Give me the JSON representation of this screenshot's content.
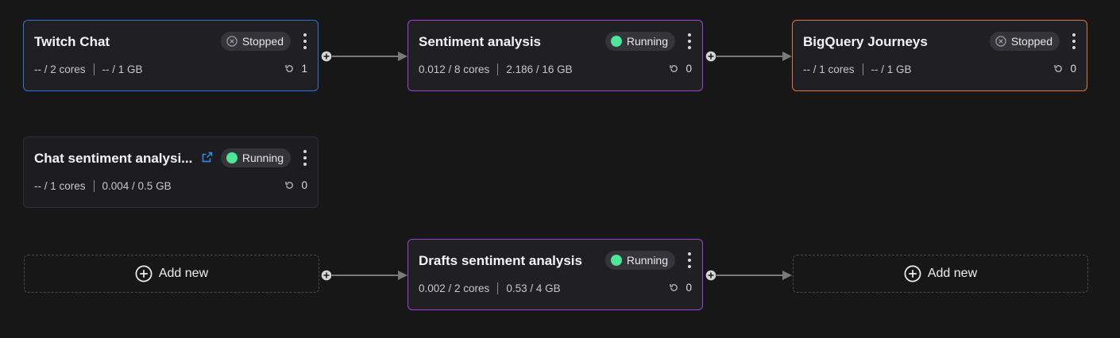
{
  "pipeline": {
    "row1": [
      {
        "title": "Twitch Chat",
        "status": "Stopped",
        "cpu": "-- / 2 cores",
        "memory": "-- / 1 GB",
        "restarts": "1",
        "border_color": "#2f6fe0"
      },
      {
        "title": "Sentiment analysis",
        "status": "Running",
        "cpu": "0.012 / 8 cores",
        "memory": "2.186 / 16 GB",
        "restarts": "0",
        "border_color": "#a33fd6"
      },
      {
        "title": "BigQuery Journeys",
        "status": "Stopped",
        "cpu": "-- / 1 cores",
        "memory": "-- / 1 GB",
        "restarts": "0",
        "border_color": "#e2733a"
      }
    ],
    "row2": [
      {
        "title": "Chat sentiment analysi...",
        "status": "Running",
        "cpu": "-- / 1 cores",
        "memory": "0.004 / 0.5 GB",
        "restarts": "0",
        "icon": "external-link-icon"
      }
    ],
    "row3": {
      "add_left_label": "Add new",
      "card": {
        "title": "Drafts sentiment analysis",
        "status": "Running",
        "cpu": "0.002 / 2 cores",
        "memory": "0.53 / 4 GB",
        "restarts": "0",
        "border_color": "#a33fd6"
      },
      "add_right_label": "Add new"
    }
  },
  "colors": {
    "background": "#171717",
    "running": "#4fe59a",
    "stopped_badge": "#34343a",
    "connector": "#7a7a7a"
  }
}
